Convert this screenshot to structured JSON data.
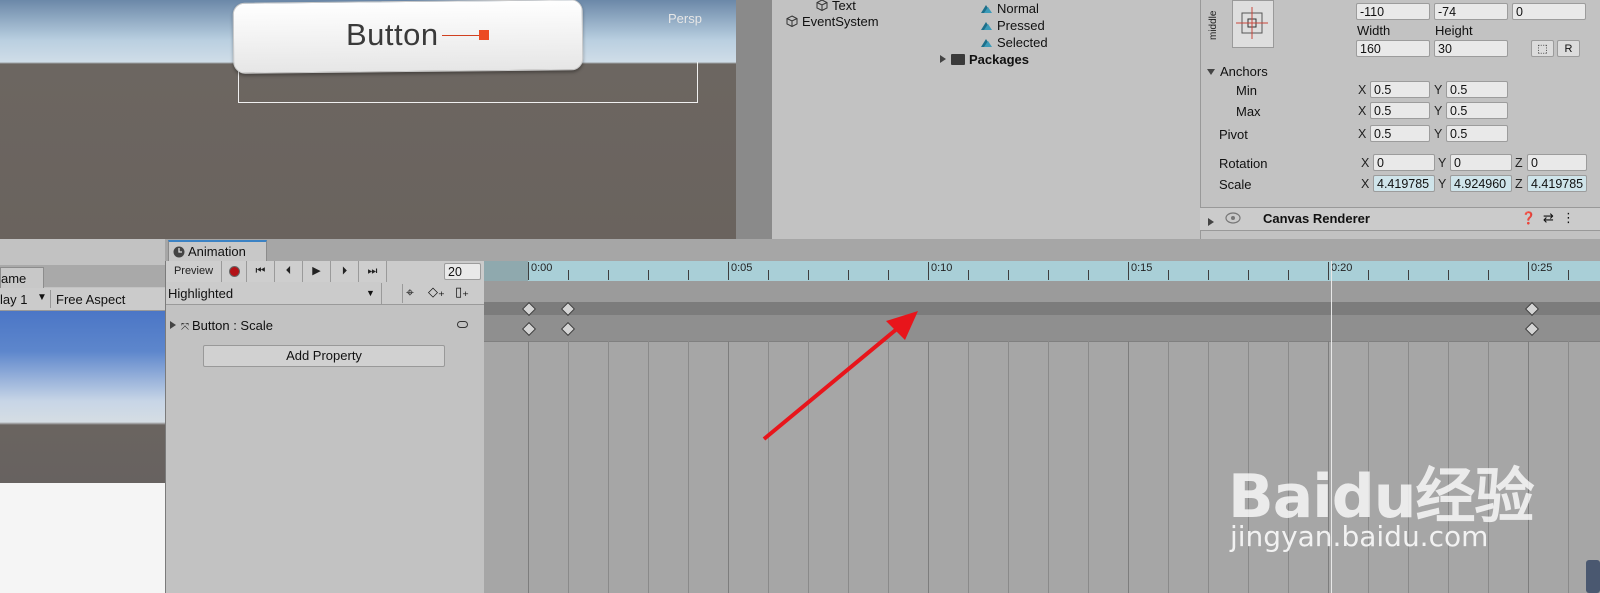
{
  "scene": {
    "button_text": "Button",
    "persp_label": "Persp"
  },
  "hierarchy": {
    "items": [
      "Text",
      "EventSystem"
    ]
  },
  "project": {
    "items": [
      "Normal",
      "Pressed",
      "Selected"
    ],
    "folder": "Packages"
  },
  "inspector": {
    "anchor_preset_label": "middle",
    "pos": [
      "-110",
      "-74",
      "0"
    ],
    "width_label": "Width",
    "height_label": "Height",
    "width": "160",
    "height": "30",
    "blueprint_btn": "⬚",
    "raw_btn": "R",
    "anchors_label": "Anchors",
    "min_label": "Min",
    "max_label": "Max",
    "pivot_label": "Pivot",
    "min": [
      "0.5",
      "0.5"
    ],
    "max": [
      "0.5",
      "0.5"
    ],
    "pivot": [
      "0.5",
      "0.5"
    ],
    "rotation_label": "Rotation",
    "rotation": [
      "0",
      "0",
      "0"
    ],
    "scale_label": "Scale",
    "scale": [
      "4.419785",
      "4.924960",
      "4.419785"
    ],
    "axis_x": "X",
    "axis_y": "Y",
    "axis_z": "Z",
    "component_name": "Canvas Renderer"
  },
  "game": {
    "tab_label": "ame",
    "display_label": "lay 1",
    "aspect_label": "Free Aspect"
  },
  "animation": {
    "tab_label": "Animation",
    "preview_label": "Preview",
    "frame": "20",
    "clip_name": "Highlighted",
    "property_label": "Button : Scale",
    "add_property_label": "Add Property",
    "ruler_labels": [
      "0:00",
      "0:05",
      "0:10",
      "0:15",
      "0:20",
      "0:25"
    ]
  },
  "watermark": {
    "logo": "Baidu经验",
    "url": "jingyan.baidu.com"
  }
}
